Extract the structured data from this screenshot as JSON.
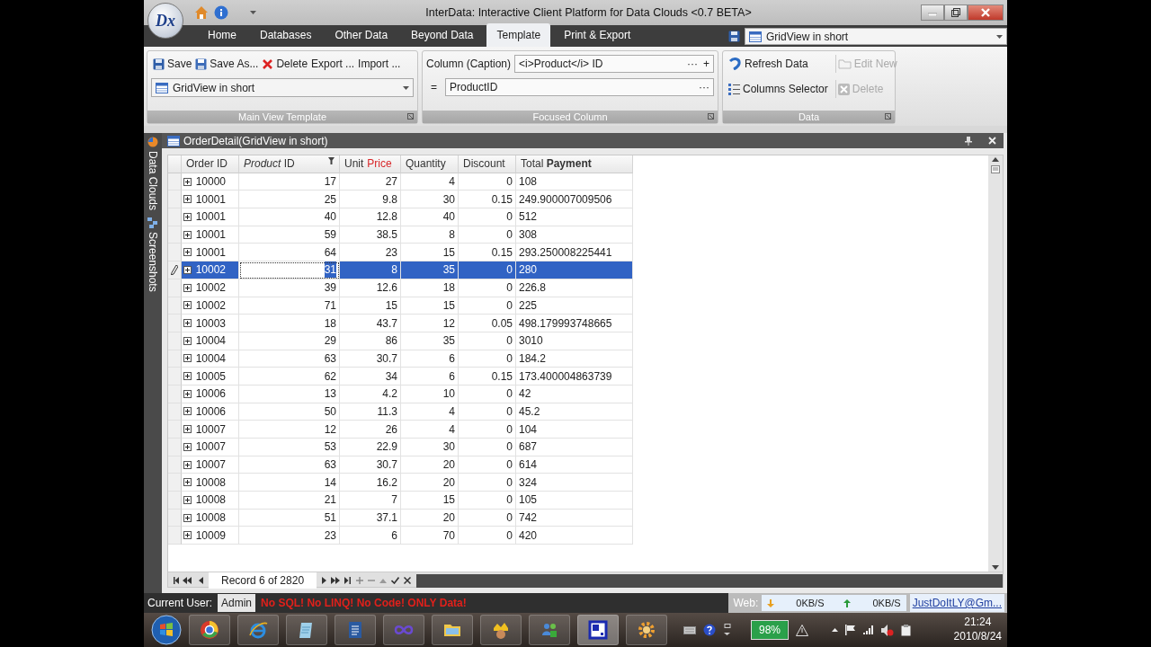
{
  "window": {
    "logo": "Dx",
    "title": "InterData: Interactive Client Platform for Data Clouds <0.7 BETA>"
  },
  "tabs": [
    {
      "label": "Home",
      "selected": false
    },
    {
      "label": "Databases",
      "selected": false
    },
    {
      "label": "Other Data",
      "selected": false
    },
    {
      "label": "Beyond Data",
      "selected": false
    },
    {
      "label": "Template",
      "selected": true
    },
    {
      "label": "Print & Export",
      "selected": false
    }
  ],
  "view_selector": {
    "value": "GridView in short"
  },
  "ribbon": {
    "groups": [
      {
        "kind": "template",
        "title": "Main View Template",
        "buttons": [
          {
            "label": "Save",
            "kind": "save"
          },
          {
            "label": "Save As...",
            "kind": "save_as"
          },
          {
            "label": "Delete",
            "kind": "delete"
          },
          {
            "label": "Export ...",
            "kind": "plain"
          },
          {
            "label": "Import ...",
            "kind": "plain"
          }
        ],
        "combo": "GridView in short"
      },
      {
        "kind": "column",
        "title": "Focused Column",
        "caption_label": "Column (Caption)",
        "caption_value": "<i>Product</i> ID",
        "caption_more": "···",
        "caption_add": "+",
        "equals": "=",
        "field_value": "ProductID",
        "field_more": "···"
      },
      {
        "kind": "data",
        "title": "Data",
        "buttons": [
          {
            "label": "Refresh Data",
            "kind": "refresh",
            "disabled": false
          },
          {
            "label": "Edit New",
            "kind": "edit",
            "disabled": true
          },
          {
            "label": "Columns Selector",
            "kind": "columns",
            "disabled": false
          },
          {
            "label": "Delete",
            "kind": "delete",
            "disabled": true
          }
        ]
      }
    ]
  },
  "side_tabs": [
    {
      "label": "Data Clouds"
    },
    {
      "label": "Screenshots"
    }
  ],
  "grid": {
    "title": "OrderDetail(GridView in short)",
    "columns": [
      {
        "label": "Order ID",
        "focused": false
      },
      {
        "label": "*Product* ID",
        "focused": true
      },
      {
        "label": "Unit",
        "accent": "Price",
        "focused": false
      },
      {
        "label": "Quantity",
        "focused": false
      },
      {
        "label": "Discount",
        "focused": false
      },
      {
        "label": "Total **Payment**",
        "focused": false
      }
    ],
    "rows": [
      {
        "cells": [
          "10000",
          "17",
          "27",
          "4",
          "0",
          "108"
        ],
        "selected": false
      },
      {
        "cells": [
          "10001",
          "25",
          "9.8",
          "30",
          "0.15",
          "249.900007009506"
        ],
        "selected": false
      },
      {
        "cells": [
          "10001",
          "40",
          "12.8",
          "40",
          "0",
          "512"
        ],
        "selected": false
      },
      {
        "cells": [
          "10001",
          "59",
          "38.5",
          "8",
          "0",
          "308"
        ],
        "selected": false
      },
      {
        "cells": [
          "10001",
          "64",
          "23",
          "15",
          "0.15",
          "293.250008225441"
        ],
        "selected": false
      },
      {
        "cells": [
          "10002",
          "31",
          "8",
          "35",
          "0",
          "280"
        ],
        "selected": true
      },
      {
        "cells": [
          "10002",
          "39",
          "12.6",
          "18",
          "0",
          "226.8"
        ],
        "selected": false
      },
      {
        "cells": [
          "10002",
          "71",
          "15",
          "15",
          "0",
          "225"
        ],
        "selected": false
      },
      {
        "cells": [
          "10003",
          "18",
          "43.7",
          "12",
          "0.05",
          "498.179993748665"
        ],
        "selected": false
      },
      {
        "cells": [
          "10004",
          "29",
          "86",
          "35",
          "0",
          "3010"
        ],
        "selected": false
      },
      {
        "cells": [
          "10004",
          "63",
          "30.7",
          "6",
          "0",
          "184.2"
        ],
        "selected": false
      },
      {
        "cells": [
          "10005",
          "62",
          "34",
          "6",
          "0.15",
          "173.400004863739"
        ],
        "selected": false
      },
      {
        "cells": [
          "10006",
          "13",
          "4.2",
          "10",
          "0",
          "42"
        ],
        "selected": false
      },
      {
        "cells": [
          "10006",
          "50",
          "11.3",
          "4",
          "0",
          "45.2"
        ],
        "selected": false
      },
      {
        "cells": [
          "10007",
          "12",
          "26",
          "4",
          "0",
          "104"
        ],
        "selected": false
      },
      {
        "cells": [
          "10007",
          "53",
          "22.9",
          "30",
          "0",
          "687"
        ],
        "selected": false
      },
      {
        "cells": [
          "10007",
          "63",
          "30.7",
          "20",
          "0",
          "614"
        ],
        "selected": false
      },
      {
        "cells": [
          "10008",
          "14",
          "16.2",
          "20",
          "0",
          "324"
        ],
        "selected": false
      },
      {
        "cells": [
          "10008",
          "21",
          "7",
          "15",
          "0",
          "105"
        ],
        "selected": false
      },
      {
        "cells": [
          "10008",
          "51",
          "37.1",
          "20",
          "0",
          "742"
        ],
        "selected": false
      },
      {
        "cells": [
          "10009",
          "23",
          "6",
          "70",
          "0",
          "420"
        ],
        "selected": false
      }
    ],
    "navigator": "Record 6 of 2820"
  },
  "status_bar": {
    "user_label": "Current User:",
    "user": "Admin",
    "slogan": "No SQL! No LINQ! No Code! ONLY Data!",
    "web_label": "Web:",
    "download": "0KB/S",
    "upload": "0KB/S",
    "account": "JustDoItLY@Gm..."
  },
  "taskbar": {
    "battery": {
      "reading": "98%",
      "level": 0.98
    },
    "time": "21:24",
    "date": "2010/8/24"
  }
}
